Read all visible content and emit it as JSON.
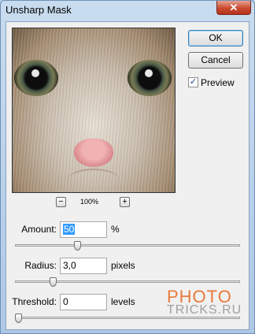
{
  "window": {
    "title": "Unsharp Mask",
    "close_glyph": "✕"
  },
  "preview": {
    "zoom_level": "100%",
    "zoom_out_label": "−",
    "zoom_in_label": "+"
  },
  "buttons": {
    "ok_label": "OK",
    "cancel_label": "Cancel"
  },
  "preview_toggle": {
    "label": "Preview",
    "checked": true,
    "check_glyph": "✓"
  },
  "amount": {
    "label": "Amount:",
    "value": "50",
    "unit": "%",
    "slider_fraction": 0.27
  },
  "radius": {
    "label": "Radius:",
    "value": "3,0",
    "unit": "pixels",
    "slider_fraction": 0.16
  },
  "threshold": {
    "label": "Threshold:",
    "value": "0",
    "unit": "levels",
    "slider_fraction": 0.0
  },
  "watermark": {
    "line1": "PHOTO",
    "line2": "TRICKS.RU"
  },
  "colors": {
    "accent": "#3399ff",
    "watermark": "#e87a3c",
    "close": "#c94a2f"
  }
}
